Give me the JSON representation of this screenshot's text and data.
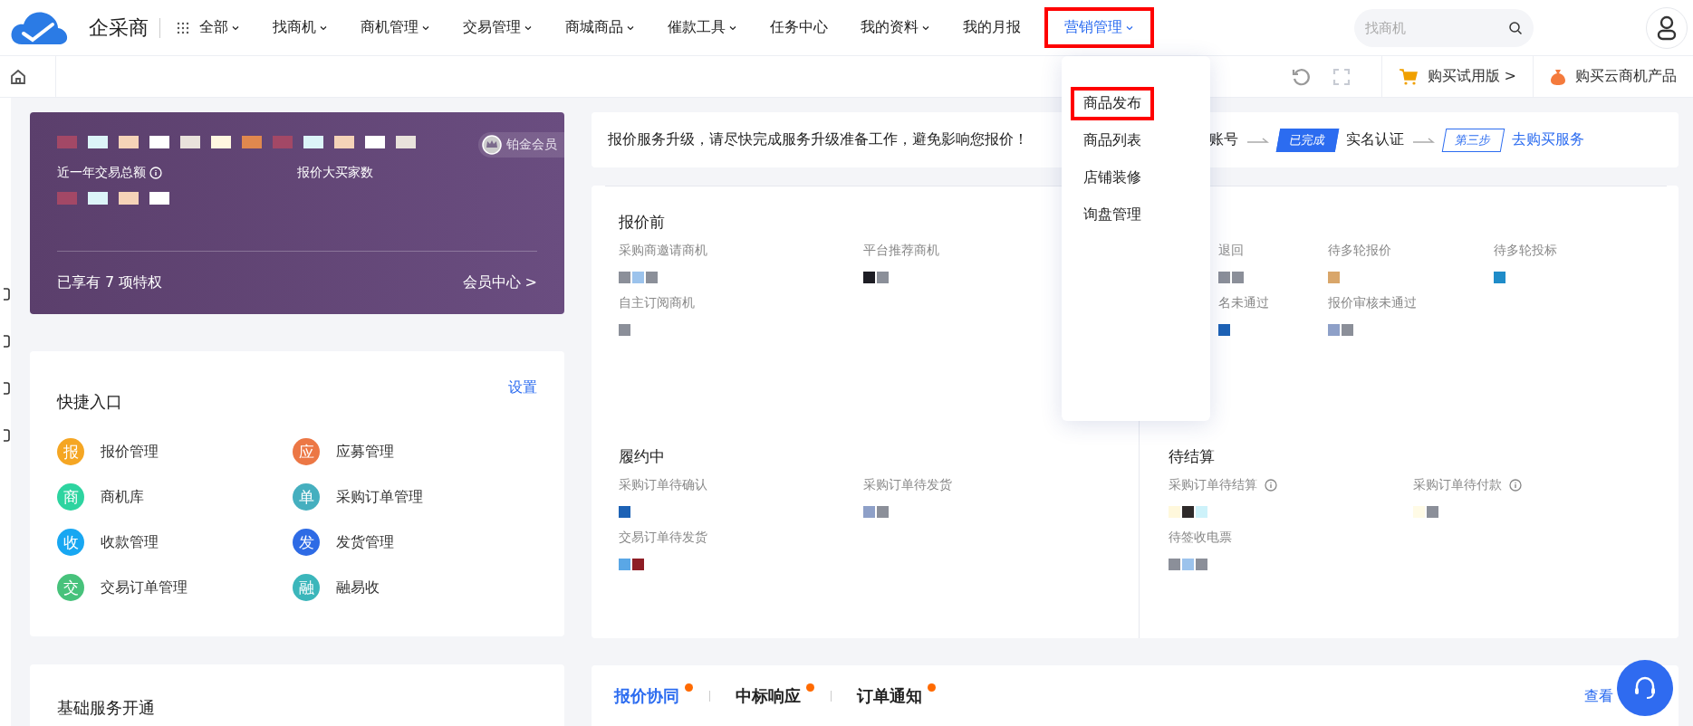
{
  "brand": {
    "name": "企采商"
  },
  "nav": [
    {
      "label": "全部",
      "has_menu": true,
      "selected": false,
      "highlighted": false,
      "kind": "grid"
    },
    {
      "label": "找商机",
      "has_menu": true,
      "selected": false,
      "highlighted": false,
      "kind": "plain"
    },
    {
      "label": "商机管理",
      "has_menu": true,
      "selected": false,
      "highlighted": false,
      "kind": "plain"
    },
    {
      "label": "交易管理",
      "has_menu": true,
      "selected": false,
      "highlighted": false,
      "kind": "plain"
    },
    {
      "label": "商城商品",
      "has_menu": true,
      "selected": false,
      "highlighted": false,
      "kind": "plain"
    },
    {
      "label": "催款工具",
      "has_menu": true,
      "selected": false,
      "highlighted": false,
      "kind": "plain"
    },
    {
      "label": "任务中心",
      "has_menu": false,
      "selected": false,
      "highlighted": false,
      "kind": "plain"
    },
    {
      "label": "我的资料",
      "has_menu": true,
      "selected": false,
      "highlighted": false,
      "kind": "plain"
    },
    {
      "label": "我的月报",
      "has_menu": false,
      "selected": false,
      "highlighted": false,
      "kind": "plain"
    },
    {
      "label": "营销管理",
      "has_menu": true,
      "selected": true,
      "highlighted": true,
      "kind": "plain"
    }
  ],
  "search": {
    "placeholder": "找商机"
  },
  "toolbar": {
    "trial": "购买试用版 >",
    "product": "购买云商机产品"
  },
  "dropdown": {
    "expanded": true,
    "items": [
      {
        "label": "商品发布",
        "highlighted": true
      },
      {
        "label": "商品列表",
        "highlighted": false
      },
      {
        "label": "店铺装修",
        "highlighted": false
      },
      {
        "label": "询盘管理",
        "highlighted": false
      }
    ]
  },
  "member_card": {
    "badge": "铂金会员",
    "stats": [
      {
        "label": "近一年交易总额",
        "info": true
      },
      {
        "label": "报价大买家数",
        "info": false
      }
    ],
    "privileges": "已享有 7 项特权",
    "center_link": "会员中心 >"
  },
  "quick_entry": {
    "title": "快捷入口",
    "settings": "设置",
    "items": [
      {
        "icon_char": "报",
        "label": "报价管理",
        "color": "#f5a623"
      },
      {
        "icon_char": "应",
        "label": "应募管理",
        "color": "#ec7745"
      },
      {
        "icon_char": "商",
        "label": "商机库",
        "color": "#2dd4a0"
      },
      {
        "icon_char": "单",
        "label": "采购订单管理",
        "color": "#45afbf"
      },
      {
        "icon_char": "收",
        "label": "收款管理",
        "color": "#18a7f2"
      },
      {
        "icon_char": "发",
        "label": "发货管理",
        "color": "#2e6be5"
      },
      {
        "icon_char": "交",
        "label": "交易订单管理",
        "color": "#47c27b"
      },
      {
        "icon_char": "融",
        "label": "融易收",
        "color": "#3bb6bb"
      }
    ]
  },
  "basic_services": {
    "title": "基础服务开通"
  },
  "notice": {
    "message": "报价服务升级，请尽快完成服务升级准备工作，避免影响您报价！",
    "steps": [
      {
        "label": "账号",
        "kind": "text"
      },
      {
        "label": "实名认证",
        "badge": "已完成",
        "kind": "done"
      },
      {
        "label": "去购买服务",
        "badge": "第三步",
        "kind": "pending"
      }
    ]
  },
  "stats": {
    "sections": [
      {
        "title": "报价前",
        "items": [
          {
            "label": "采购商邀请商机",
            "info": false
          },
          {
            "label": "平台推荐商机",
            "info": false
          },
          {
            "label": "自主订阅商机",
            "info": false
          }
        ]
      },
      {
        "items": [
          {
            "label": "退回",
            "info": false
          },
          {
            "label": "待多轮报价",
            "info": false
          },
          {
            "label": "待多轮投标",
            "info": false
          },
          {
            "label": "名未通过",
            "info": false
          },
          {
            "label": "报价审核未通过",
            "info": false
          }
        ]
      },
      {
        "title": "履约中",
        "items": [
          {
            "label": "采购订单待确认",
            "info": false
          },
          {
            "label": "采购订单待发货",
            "info": false
          },
          {
            "label": "交易订单待发货",
            "info": false
          }
        ]
      },
      {
        "title": "待结算",
        "items": [
          {
            "label": "采购订单待结算",
            "info": true
          },
          {
            "label": "采购订单待付款",
            "info": true
          },
          {
            "label": "待签收电票",
            "info": false
          }
        ]
      }
    ]
  },
  "messages": {
    "tabs": [
      {
        "label": "报价协同",
        "selected": true,
        "unread": true
      },
      {
        "label": "中标响应",
        "selected": false,
        "unread": true
      },
      {
        "label": "订单通知",
        "selected": false,
        "unread": true
      }
    ],
    "more": "查看"
  }
}
